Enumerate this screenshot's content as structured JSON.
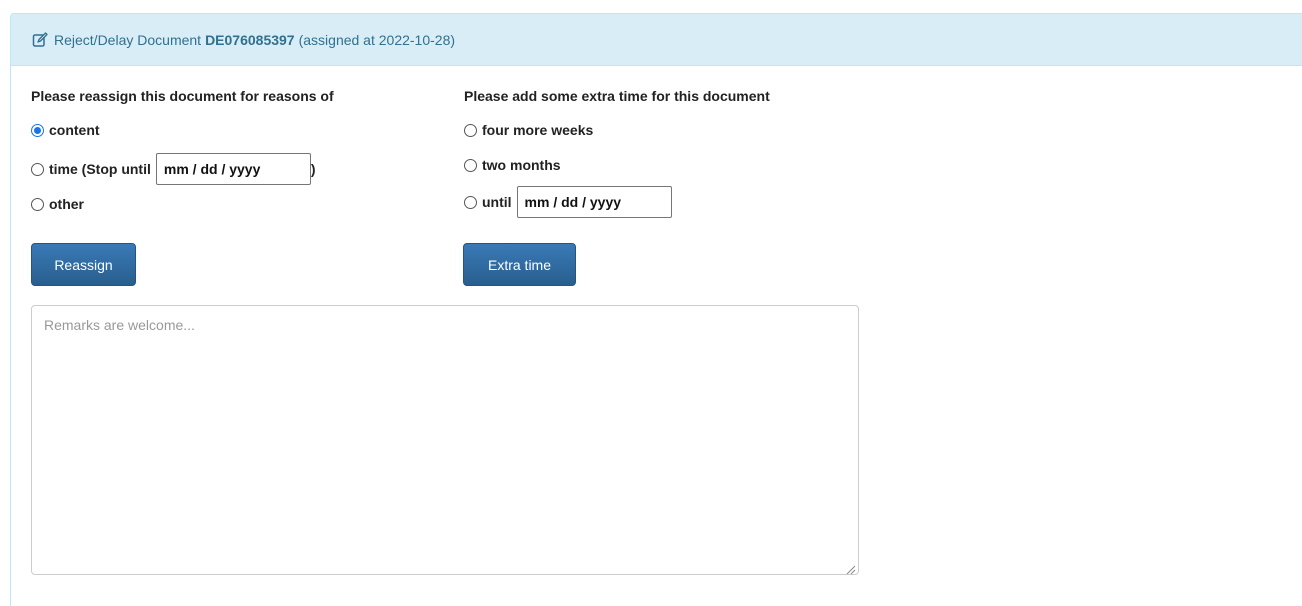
{
  "header": {
    "prefix": "Reject/Delay Document",
    "doc_id": "DE076085397",
    "suffix": "(assigned at 2022-10-28)",
    "icon": "edit-icon"
  },
  "reassign": {
    "title": "Please reassign this document for reasons of",
    "options": [
      {
        "label": "content",
        "checked": true
      },
      {
        "label": "time (Stop until",
        "checked": false
      },
      {
        "label": "other",
        "checked": false
      }
    ],
    "date_placeholder": "mm / dd / yyyy",
    "close_paren": ")",
    "button_label": "Reassign"
  },
  "extra": {
    "title": "Please add some extra time for this document",
    "options": [
      {
        "label": "four more weeks",
        "checked": false
      },
      {
        "label": "two months",
        "checked": false
      },
      {
        "label": "until",
        "checked": false
      }
    ],
    "date_placeholder": "mm / dd / yyyy",
    "button_label": "Extra time"
  },
  "remarks": {
    "placeholder": "Remarks are welcome..."
  },
  "colors": {
    "heading_bg": "#d9edf7",
    "heading_text": "#31708f",
    "button_bg": "#286090",
    "radio_checked": "#1a73e8"
  }
}
